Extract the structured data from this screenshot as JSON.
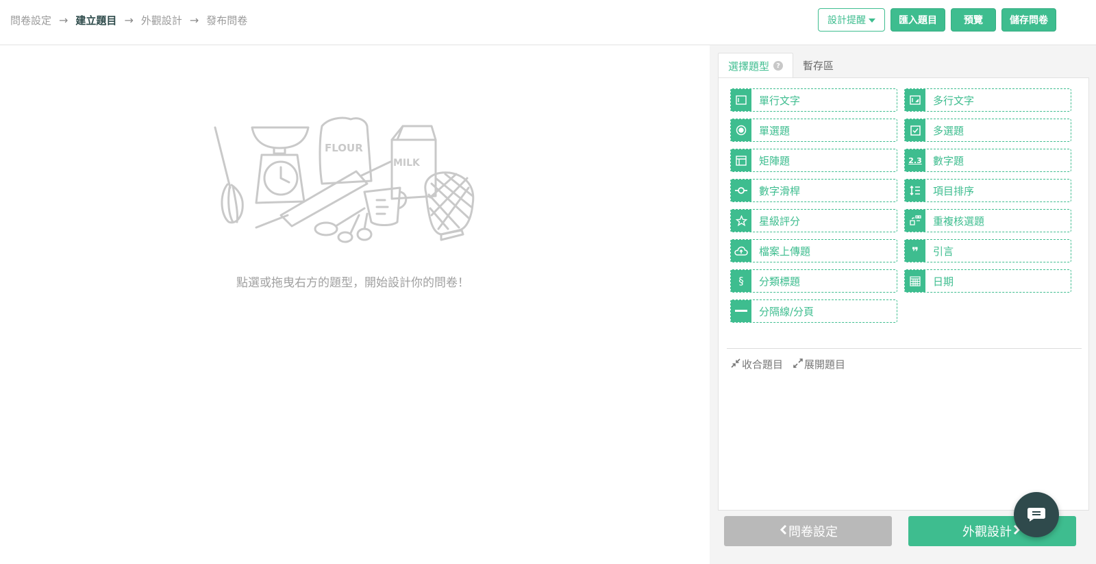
{
  "breadcrumb": {
    "steps": [
      {
        "label": "問卷設定"
      },
      {
        "label": "建立題目"
      },
      {
        "label": "外觀設計"
      },
      {
        "label": "發布問卷"
      }
    ],
    "arrow": "→"
  },
  "header_buttons": {
    "tips": "設計提醒",
    "import": "匯入題目",
    "preview": "預覽",
    "save": "儲存問卷"
  },
  "canvas": {
    "empty_message": "點選或拖曳右方的題型，開始設計你的問卷！",
    "illustration_labels": {
      "flour": "FLOUR",
      "milk": "MILK"
    }
  },
  "panel": {
    "tabs": [
      {
        "label": "選擇題型",
        "active": true
      },
      {
        "label": "暫存區",
        "active": false
      }
    ],
    "help_glyph": "?",
    "question_types": [
      {
        "label": "單行文字",
        "icon": "single-line-text-icon"
      },
      {
        "label": "多行文字",
        "icon": "multi-line-text-icon"
      },
      {
        "label": "單選題",
        "icon": "radio-icon"
      },
      {
        "label": "多選題",
        "icon": "checkbox-icon"
      },
      {
        "label": "矩陣題",
        "icon": "matrix-icon"
      },
      {
        "label": "數字題",
        "icon": "number-icon"
      },
      {
        "label": "數字滑桿",
        "icon": "slider-icon"
      },
      {
        "label": "項目排序",
        "icon": "ranking-icon"
      },
      {
        "label": "星級評分",
        "icon": "star-icon"
      },
      {
        "label": "重複核選題",
        "icon": "repeat-check-icon"
      },
      {
        "label": "檔案上傳題",
        "icon": "cloud-upload-icon"
      },
      {
        "label": "引言",
        "icon": "quote-icon"
      },
      {
        "label": "分類標題",
        "icon": "section-icon"
      },
      {
        "label": "日期",
        "icon": "calendar-icon"
      },
      {
        "label": "分隔線/分頁",
        "icon": "divider-icon"
      }
    ],
    "number_icon_text": "2.3",
    "section_icon_text": "§",
    "quote_icon_text": "❞",
    "collapse": "收合題目",
    "expand": "展開題目"
  },
  "footer": {
    "prev": "問卷設定",
    "next": "外觀設計"
  },
  "colors": {
    "accent": "#3ebd8f",
    "chat": "#2f4a4c",
    "prev_button": "#b9b9b9"
  }
}
